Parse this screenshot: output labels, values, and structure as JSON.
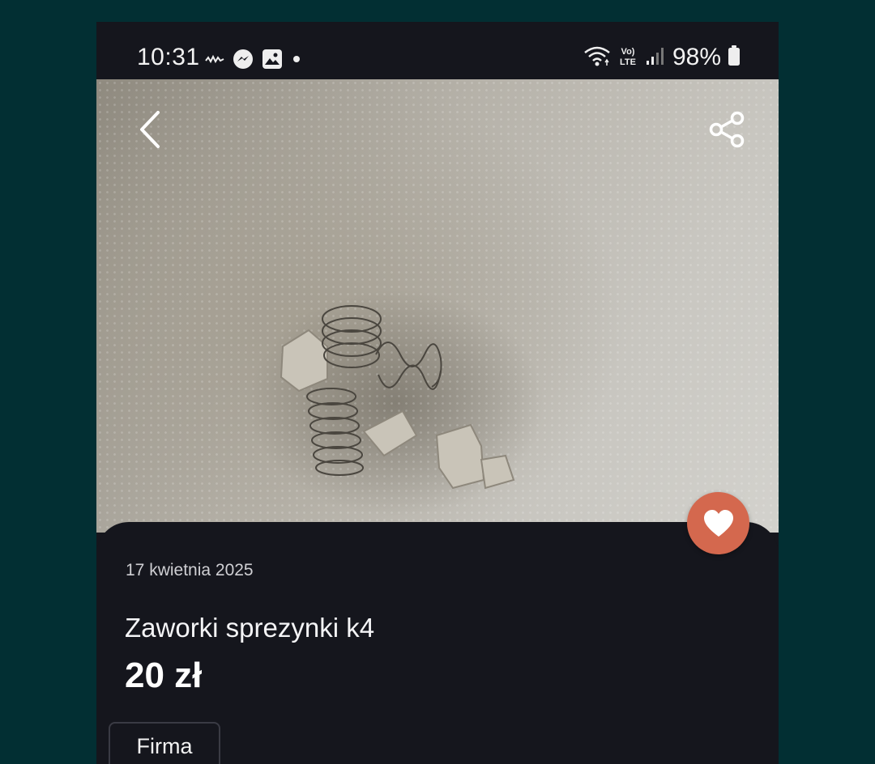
{
  "statusbar": {
    "time": "10:31",
    "battery_percent": "98%",
    "left_icons": [
      "signal-wave-icon",
      "messenger-icon",
      "gallery-icon",
      "dot-icon"
    ],
    "right_icons": [
      "wifi-icon",
      "volte-icon",
      "cell-signal-icon",
      "battery-icon"
    ],
    "volte_label": "Vo) LTE"
  },
  "listing": {
    "date": "17 kwietnia 2025",
    "title": "Zaworki sprezynki k4",
    "price": "20 zł",
    "tag": "Firma"
  },
  "colors": {
    "page_bg": "#022f33",
    "surface": "#15161d",
    "favorite": "#d4684e"
  }
}
